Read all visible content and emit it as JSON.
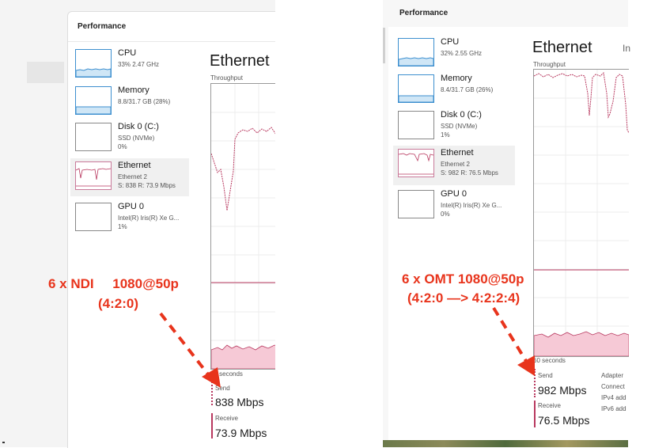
{
  "left": {
    "window_title": "Performance",
    "sidebar": [
      {
        "name": "CPU",
        "sub1": "33%  2.47 GHz",
        "sub2": "",
        "sub3": ""
      },
      {
        "name": "Memory",
        "sub1": "8.8/31.7 GB (28%)",
        "sub2": "",
        "sub3": ""
      },
      {
        "name": "Disk 0 (C:)",
        "sub1": "SSD (NVMe)",
        "sub2": "0%",
        "sub3": ""
      },
      {
        "name": "Ethernet",
        "sub1": "Ethernet 2",
        "sub2": "S: 838  R: 73.9 Mbps",
        "sub3": ""
      },
      {
        "name": "GPU 0",
        "sub1": "Intel(R) Iris(R) Xe G...",
        "sub2": "1%",
        "sub3": ""
      }
    ],
    "detail_title": "Ethernet",
    "throughput_label": "Throughput",
    "seconds_label": "60 seconds",
    "send_label": "Send",
    "send_value": "838 Mbps",
    "receive_label": "Receive",
    "receive_value": "73.9 Mbps",
    "annotation_line1": "6 x NDI     1080@50p",
    "annotation_line2": "(4:2:0)"
  },
  "right": {
    "window_title": "Performance",
    "sidebar": [
      {
        "name": "CPU",
        "sub1": "32%  2.55 GHz",
        "sub2": "",
        "sub3": ""
      },
      {
        "name": "Memory",
        "sub1": "8.4/31.7 GB (26%)",
        "sub2": "",
        "sub3": ""
      },
      {
        "name": "Disk 0 (C:)",
        "sub1": "SSD (NVMe)",
        "sub2": "1%",
        "sub3": ""
      },
      {
        "name": "Ethernet",
        "sub1": "Ethernet 2",
        "sub2": "S: 982  R: 76.5 Mbps",
        "sub3": ""
      },
      {
        "name": "GPU 0",
        "sub1": "Intel(R) Iris(R) Xe G...",
        "sub2": "0%",
        "sub3": ""
      }
    ],
    "detail_title": "Ethernet",
    "detail_title_cut": "In",
    "throughput_label": "Throughput",
    "seconds_label": "60 seconds",
    "send_label": "Send",
    "send_value": "982 Mbps",
    "receive_label": "Receive",
    "receive_value": "76.5 Mbps",
    "adapter_labels": [
      "Adapter",
      "Connect",
      "IPv4 add",
      "IPv6 add"
    ],
    "annotation_line1": "6 x OMT 1080@50p",
    "annotation_line2": "(4:2:0 —> 4:2:2:4)"
  },
  "colors": {
    "annotation": "#e8341c",
    "send_line": "#b8385f",
    "receive_fill": "#f6c9d6",
    "cpu_accent": "#3d8fcf"
  }
}
